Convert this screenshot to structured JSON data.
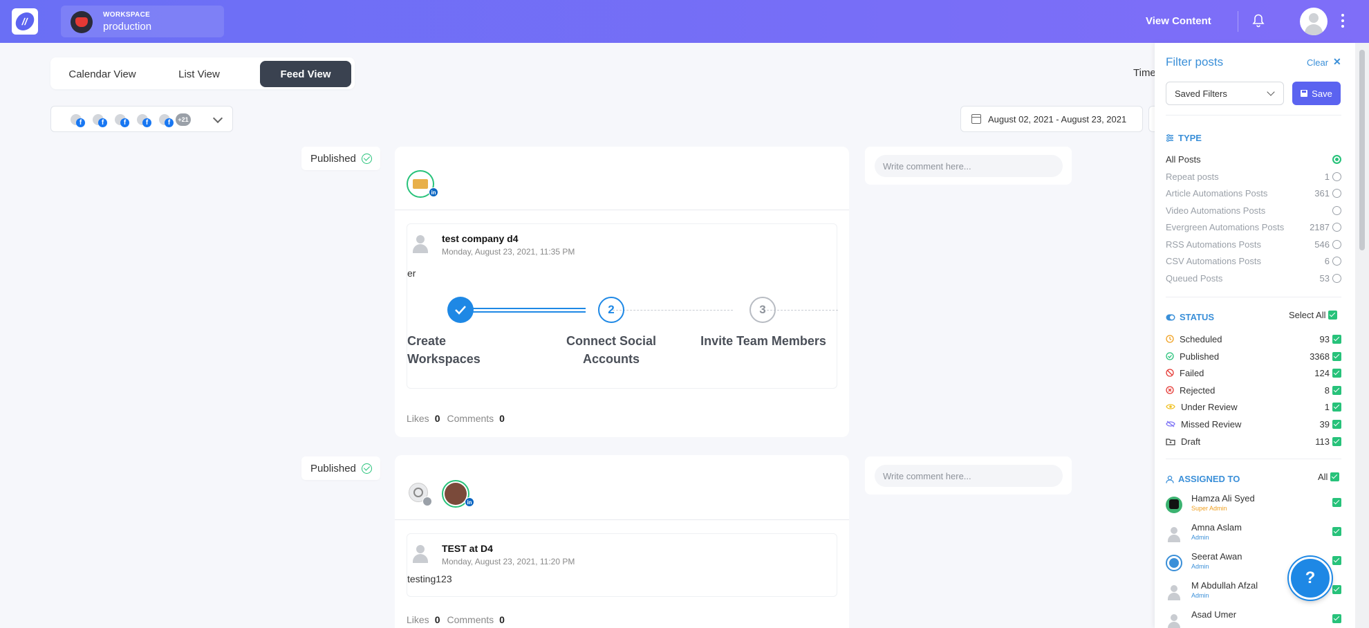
{
  "header": {
    "workspace_label": "WORKSPACE",
    "workspace_name": "production",
    "view_content": "View Content"
  },
  "views": {
    "calendar": "Calendar View",
    "list": "List View",
    "feed": "Feed View",
    "active": "Feed View"
  },
  "time_label": "Time",
  "accounts": {
    "more_count": "+21",
    "facebook_glyph": "f"
  },
  "date_range": "August 02, 2021 - August 23, 2021",
  "posts": [
    {
      "status": "Published",
      "author": "test company d4",
      "date": "Monday, August 23, 2021, 11:35 PM",
      "text": "er",
      "likes_label": "Likes",
      "likes": "0",
      "comments_label": "Comments",
      "comments": "0",
      "comment_placeholder": "Write comment here...",
      "steps": [
        {
          "number": "",
          "label": "Create Workspaces",
          "state": "done"
        },
        {
          "number": "2",
          "label": "Connect Social Accounts",
          "state": "current"
        },
        {
          "number": "3",
          "label": "Invite Team Members",
          "state": "pending"
        }
      ]
    },
    {
      "status": "Published",
      "author": "TEST at D4",
      "date": "Monday, August 23, 2021, 11:20 PM",
      "text": "testing123",
      "likes_label": "Likes",
      "likes": "0",
      "comments_label": "Comments",
      "comments": "0",
      "comment_placeholder": "Write comment here..."
    }
  ],
  "filter": {
    "title": "Filter posts",
    "clear": "Clear",
    "saved_filters": "Saved Filters",
    "save": "Save",
    "type_heading": "TYPE",
    "types": [
      {
        "label": "All Posts",
        "count": "",
        "selected": true
      },
      {
        "label": "Repeat posts",
        "count": "1",
        "selected": false
      },
      {
        "label": "Article Automations Posts",
        "count": "361",
        "selected": false
      },
      {
        "label": "Video Automations Posts",
        "count": "",
        "selected": false
      },
      {
        "label": "Evergreen Automations Posts",
        "count": "2187",
        "selected": false
      },
      {
        "label": "RSS Automations Posts",
        "count": "546",
        "selected": false
      },
      {
        "label": "CSV Automations Posts",
        "count": "6",
        "selected": false
      },
      {
        "label": "Queued Posts",
        "count": "53",
        "selected": false
      }
    ],
    "status_heading": "STATUS",
    "select_all": "Select All",
    "statuses": [
      {
        "label": "Scheduled",
        "count": "93",
        "icon": "clock-icon",
        "color": "#f0a020"
      },
      {
        "label": "Published",
        "count": "3368",
        "icon": "check-circle-icon",
        "color": "#27c27a"
      },
      {
        "label": "Failed",
        "count": "124",
        "icon": "ban-icon",
        "color": "#e53935"
      },
      {
        "label": "Rejected",
        "count": "8",
        "icon": "x-circle-icon",
        "color": "#e53935"
      },
      {
        "label": "Under Review",
        "count": "1",
        "icon": "eye-icon",
        "color": "#f0c020"
      },
      {
        "label": "Missed Review",
        "count": "39",
        "icon": "eye-slash-icon",
        "color": "#7a6ff5"
      },
      {
        "label": "Draft",
        "count": "113",
        "icon": "folder-icon",
        "color": "#444444"
      }
    ],
    "assigned_heading": "ASSIGNED TO",
    "all": "All",
    "members": [
      {
        "name": "Hamza Ali Syed",
        "role": "Super Admin"
      },
      {
        "name": "Amna Aslam",
        "role": "Admin"
      },
      {
        "name": "Seerat Awan",
        "role": "Admin"
      },
      {
        "name": "M Abdullah Afzal",
        "role": "Admin"
      },
      {
        "name": "Asad Umer",
        "role": ""
      }
    ]
  },
  "help": "?",
  "colors": {
    "accent": "#5b63f0",
    "header_start": "#6a6ff5",
    "header_end": "#7f6ef8",
    "success": "#27c27a",
    "link": "#3a8fd8"
  }
}
